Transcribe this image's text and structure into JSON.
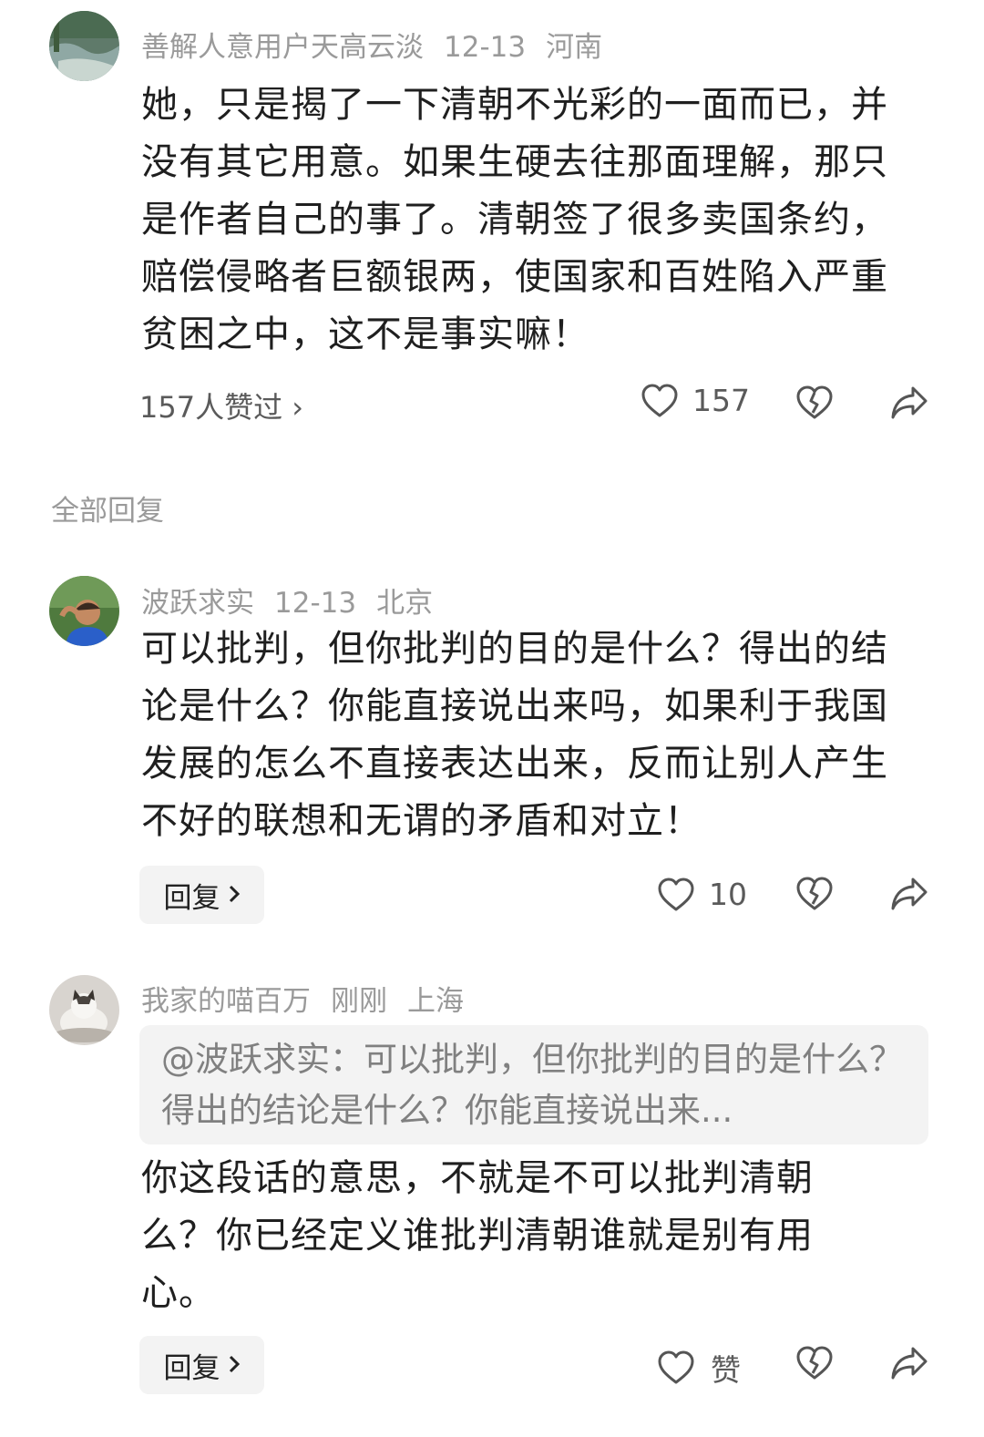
{
  "main_comment": {
    "username": "善解人意用户天高云淡",
    "date": "12-13",
    "location": "河南",
    "text": "她，只是揭了一下清朝不光彩的一面而已，并没有其它用意。如果生硬去往那面理解，那只是作者自己的事了。清朝签了很多卖国条约，赔偿侵略者巨额银两，使国家和百姓陷入严重贫困之中，这不是事实嘛！",
    "liked_by": "157人赞过 ›",
    "like_count": "157"
  },
  "section_title": "全部回复",
  "replies": [
    {
      "username": "波跃求实",
      "date": "12-13",
      "location": "北京",
      "text": "可以批判，但你批判的目的是什么？得出的结论是什么？你能直接说出来吗，如果利于我国发展的怎么不直接表达出来，反而让别人产生不好的联想和无谓的矛盾和对立！",
      "reply_label": "回复",
      "like_count": "10"
    },
    {
      "username": "我家的喵百万",
      "date": "刚刚",
      "location": "上海",
      "quote": "@波跃求实：可以批判，但你批判的目的是什么？得出的结论是什么？你能直接说出来...",
      "text": "你这段话的意思，不就是不可以批判清朝么？你已经定义谁批判清朝谁就是别有用心。",
      "reply_label": "回复",
      "like_label": "赞"
    }
  ],
  "icons": {
    "like": "heart-icon",
    "dislike": "broken-heart-icon",
    "share": "share-arrow-icon",
    "chevron": "chevron-right-icon"
  },
  "colors": {
    "text": "#1f1f1f",
    "meta": "#9a9a9a",
    "button_bg": "#f3f3f3"
  }
}
